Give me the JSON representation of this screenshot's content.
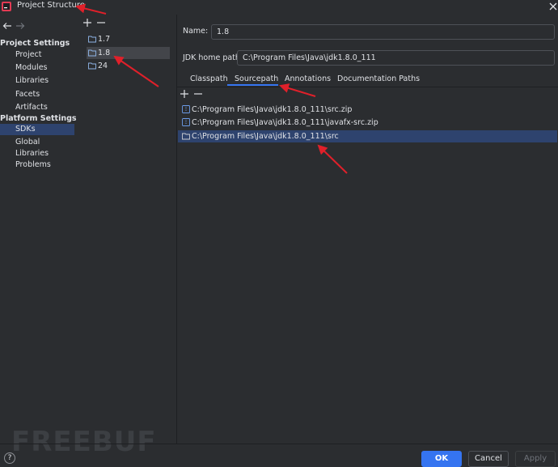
{
  "window": {
    "title": "Project Structure"
  },
  "sidebar": {
    "project_settings_heading": "Project Settings",
    "project_items": [
      "Project",
      "Modules",
      "Libraries",
      "Facets",
      "Artifacts"
    ],
    "platform_settings_heading": "Platform Settings",
    "platform_items": [
      "SDKs",
      "Global Libraries"
    ],
    "selected_item": "SDKs",
    "problems_label": "Problems"
  },
  "sdk_list": {
    "items": [
      "1.7",
      "1.8",
      "24"
    ],
    "selected": "1.8"
  },
  "detail": {
    "name_label": "Name:",
    "name_value": "1.8",
    "home_label": "JDK home path:",
    "home_value": "C:\\Program Files\\Java\\jdk1.8.0_111",
    "tabs": [
      "Classpath",
      "Sourcepath",
      "Annotations",
      "Documentation Paths"
    ],
    "active_tab": "Sourcepath",
    "paths": [
      "C:\\Program Files\\Java\\jdk1.8.0_111\\src.zip",
      "C:\\Program Files\\Java\\jdk1.8.0_111\\javafx-src.zip",
      "C:\\Program Files\\Java\\jdk1.8.0_111\\src"
    ],
    "selected_path_index": 2
  },
  "buttons": {
    "ok": "OK",
    "cancel": "Cancel",
    "apply": "Apply",
    "help": "?"
  },
  "watermark": "FREEBUF",
  "colors": {
    "background": "#2b2d30",
    "selection": "#2e436e",
    "accent": "#3574f0",
    "annotation_arrow": "#e0202a"
  }
}
